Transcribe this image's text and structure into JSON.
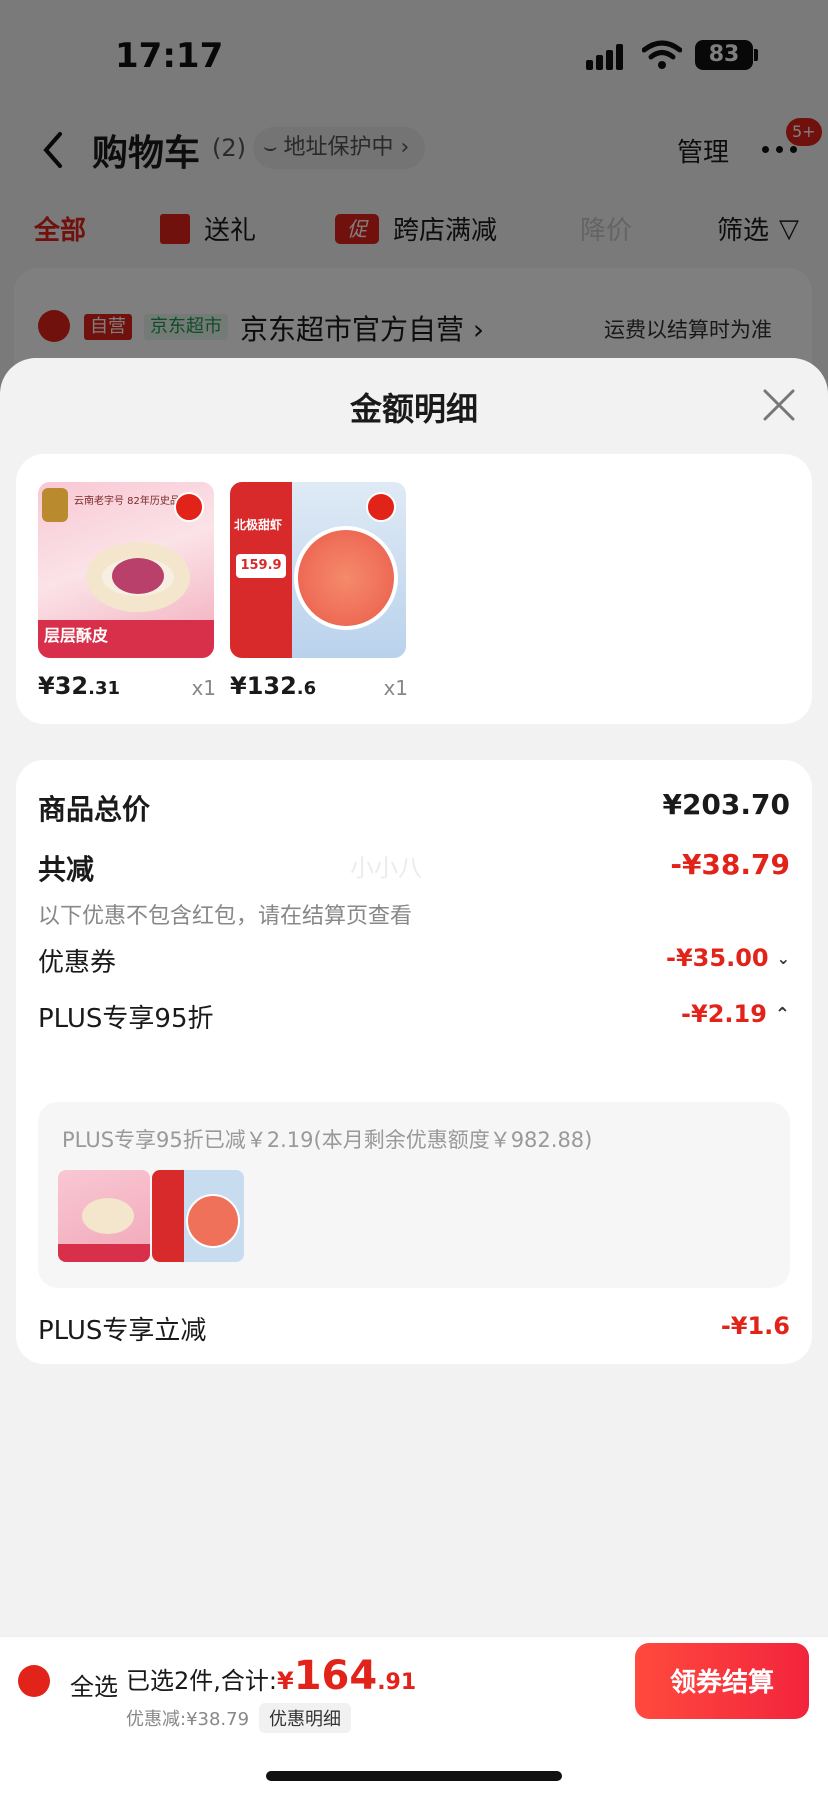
{
  "status": {
    "time": "17:17",
    "battery": "83"
  },
  "nav": {
    "title": "购物车",
    "count": "(2)",
    "address_protect": "地址保护中 ›",
    "manage": "管理",
    "badge": "5+"
  },
  "tabs": {
    "all": "全部",
    "gift": "送礼",
    "promo_tag": "促",
    "cross_store": "跨店满减",
    "price_drop": "降价",
    "filter": "筛选"
  },
  "store": {
    "self_tag": "自营",
    "super_tag": "京东超市",
    "name": "京东超市官方自营 ›",
    "shipping_note": "运费以结算时为准"
  },
  "sheet": {
    "title": "金额明细",
    "products": [
      {
        "price_int": "¥32",
        "price_dec": ".31",
        "qty": "x1",
        "img_text_1": "层层酥皮",
        "img_text_2": "云南老字号 82年历史品牌"
      },
      {
        "price_int": "¥132",
        "price_dec": ".6",
        "qty": "x1",
        "img_text_1": "北极甜虾",
        "img_text_2": "159.9"
      }
    ],
    "total_label": "商品总价",
    "total_value": "¥203.70",
    "discount_label": "共减",
    "discount_value": "-¥38.79",
    "discount_note": "以下优惠不包含红包，请在结算页查看",
    "watermark": "小小八",
    "coupon_label": "优惠券",
    "coupon_value": "-¥35.00",
    "plus95_label": "PLUS专享95折",
    "plus95_value": "-¥2.19",
    "plus95_note": "PLUS专享95折已减￥2.19(本月剩余优惠额度￥982.88)",
    "plus_instant_label": "PLUS专享立减",
    "plus_instant_value": "-¥1.6"
  },
  "bottom": {
    "select_all": "全选",
    "selected_text": "已选2件,合计:",
    "total_yen": "¥",
    "total_int": "164",
    "total_dec": ".91",
    "discount_text": "优惠减:¥38.79",
    "detail_btn": "优惠明细",
    "checkout": "领券结算"
  },
  "colors": {
    "accent": "#e2231a",
    "green": "#1f9a52"
  }
}
